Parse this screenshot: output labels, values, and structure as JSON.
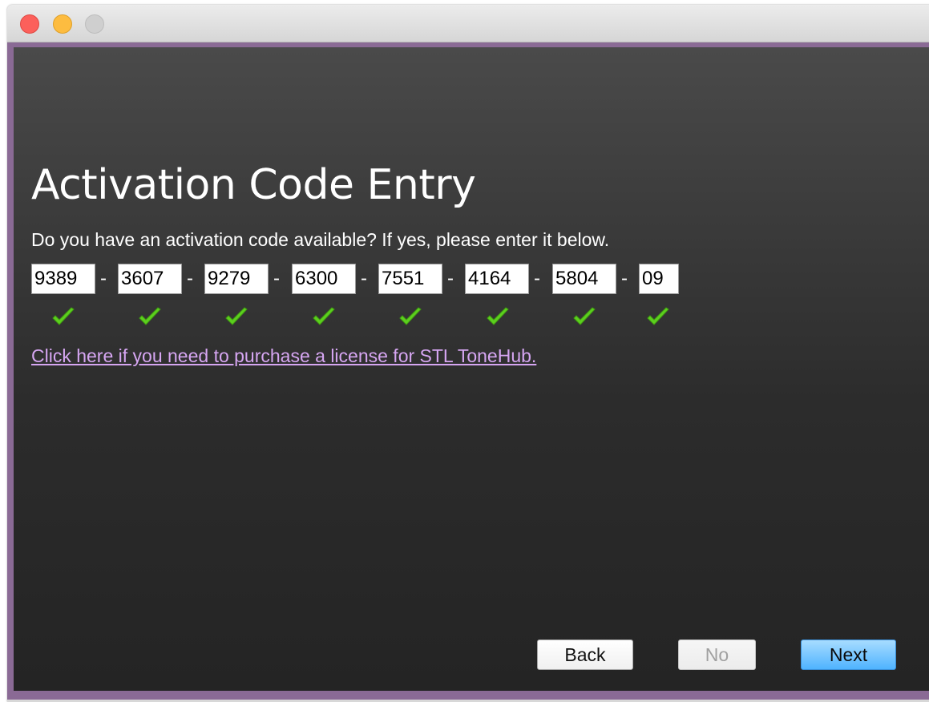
{
  "window": {
    "controls": {
      "close": "close-icon",
      "minimize": "minimize-icon",
      "zoom": "zoom-icon"
    }
  },
  "page": {
    "title": "Activation Code Entry",
    "prompt": "Do you have an activation code available? If yes, please enter it below."
  },
  "activation_code": {
    "separator": "-",
    "segments": [
      {
        "value": "9389",
        "valid": true
      },
      {
        "value": "3607",
        "valid": true
      },
      {
        "value": "9279",
        "valid": true
      },
      {
        "value": "6300",
        "valid": true
      },
      {
        "value": "7551",
        "valid": true
      },
      {
        "value": "4164",
        "valid": true
      },
      {
        "value": "5804",
        "valid": true
      },
      {
        "value": "09",
        "valid": true
      }
    ],
    "valid_icon": "checkmark-icon",
    "valid_color": "#5ccf1e"
  },
  "purchase_link": {
    "label": "Click here if you need to purchase a license for STL ToneHub."
  },
  "buttons": {
    "back": {
      "label": "Back",
      "enabled": true
    },
    "no": {
      "label": "No",
      "enabled": false
    },
    "next": {
      "label": "Next",
      "enabled": true,
      "default": true
    }
  },
  "colors": {
    "frame_border": "#8a6a95",
    "link": "#d6a6f2",
    "default_button": "#4fb3ff",
    "traffic_close": "#fc605b",
    "traffic_minimize": "#fdbc40",
    "traffic_zoom_inactive": "#cfcfcf"
  }
}
